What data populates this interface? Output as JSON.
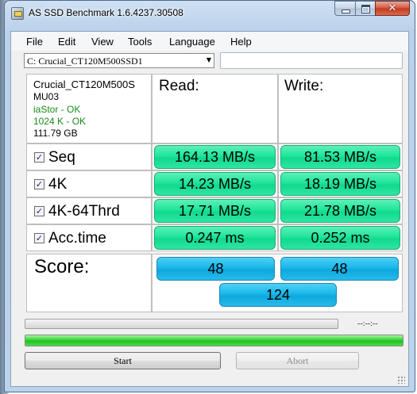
{
  "window": {
    "title": "AS SSD Benchmark 1.6.4237.30508"
  },
  "menu": {
    "items": [
      "File",
      "Edit",
      "View",
      "Tools",
      "Language",
      "Help"
    ]
  },
  "drive_select": {
    "value": "C: Crucial_CT120M500SSD1",
    "arrow_icon": "chevron-down-icon"
  },
  "drive_info": {
    "model": "Crucial_CT120M500S",
    "firmware": "MU03",
    "driver": "iaStor - OK",
    "alignment": "1024 K - OK",
    "capacity": "111.79 GB"
  },
  "columns": {
    "read": "Read:",
    "write": "Write:"
  },
  "rows": [
    {
      "label": "Seq",
      "checked": true,
      "read": "164.13 MB/s",
      "write": "81.53 MB/s"
    },
    {
      "label": "4K",
      "checked": true,
      "read": "14.23 MB/s",
      "write": "18.19 MB/s"
    },
    {
      "label": "4K-64Thrd",
      "checked": true,
      "read": "17.71 MB/s",
      "write": "21.78 MB/s"
    },
    {
      "label": "Acc.time",
      "checked": true,
      "read": "0.247 ms",
      "write": "0.252 ms"
    }
  ],
  "score": {
    "label": "Score:",
    "read": "48",
    "write": "48",
    "total": "124"
  },
  "progress": {
    "time_readout": "--:--:--",
    "test_progress_fraction": 0,
    "total_progress_fraction": 1
  },
  "buttons": {
    "start": "Start",
    "abort": "Abort"
  },
  "colors": {
    "result_green": "#1ee69a",
    "score_blue": "#1ab7ea",
    "progress_green": "#1ec21f",
    "info_green": "#1a8a1a"
  }
}
